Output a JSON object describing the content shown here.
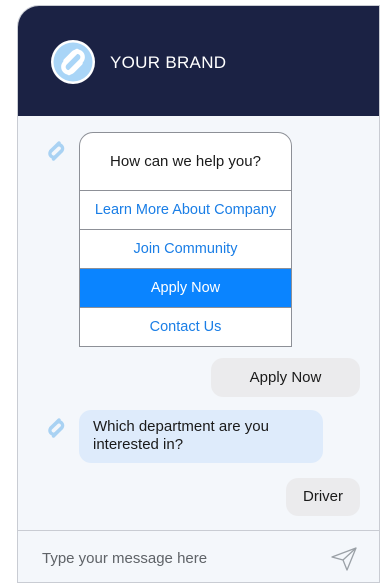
{
  "header": {
    "brand_name": "YOUR BRAND",
    "logo_icon": "brand-logo-icon",
    "background_color": "#1b2244"
  },
  "messages": {
    "menu": {
      "title": "How can we help you?",
      "options": [
        {
          "label": "Learn More About Company",
          "selected": false
        },
        {
          "label": "Join Community",
          "selected": false
        },
        {
          "label": "Apply Now",
          "selected": true
        },
        {
          "label": "Contact Us",
          "selected": false
        }
      ]
    },
    "user_reply_1": "Apply Now",
    "bot_question": "Which department are you interested in?",
    "user_reply_2": "Driver"
  },
  "composer": {
    "placeholder": "Type your message here",
    "send_icon": "paper-plane-icon"
  },
  "colors": {
    "accent": "#0a84ff",
    "link": "#1a7ee6",
    "bot_bubble": "#deebfb",
    "user_bubble": "#ebebed"
  }
}
